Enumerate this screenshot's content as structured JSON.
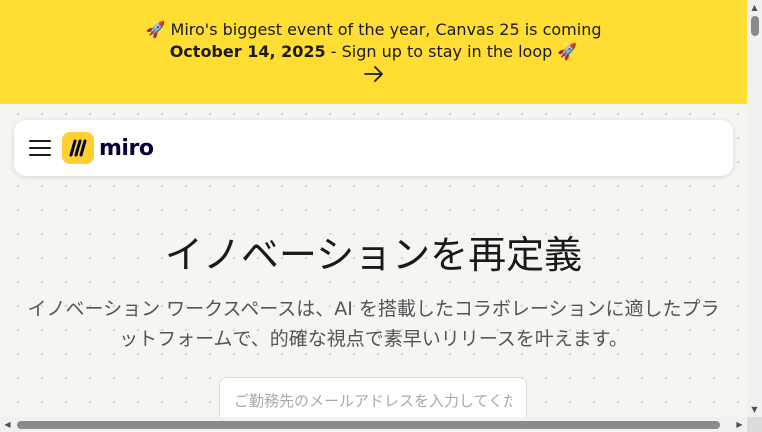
{
  "banner": {
    "line1_prefix": "🚀 ",
    "line1_text": "Miro's biggest event of the year, Canvas 25 is coming",
    "line2_date": "October 14, 2025",
    "line2_text": " - Sign up to stay in the loop ",
    "line2_suffix": "🚀",
    "arrow": "→",
    "background": "#ffdd33"
  },
  "navbar": {
    "logo_text": "miro",
    "logo_color": "#ffd02f"
  },
  "hero": {
    "title": "イノベーションを再定義",
    "subtitle": "イノベーション ワークスペースは、AI を搭載したコラボレーションに適したプラットフォームで、的確な視点で素早いリリースを叶えます。"
  },
  "signup": {
    "email_placeholder": "ご勤務先のメールアドレスを入力してください",
    "email_value": ""
  },
  "scrollbars": {
    "up_arrow": "▲",
    "down_arrow": "▼",
    "left_arrow": "◀",
    "right_arrow": "▶"
  }
}
